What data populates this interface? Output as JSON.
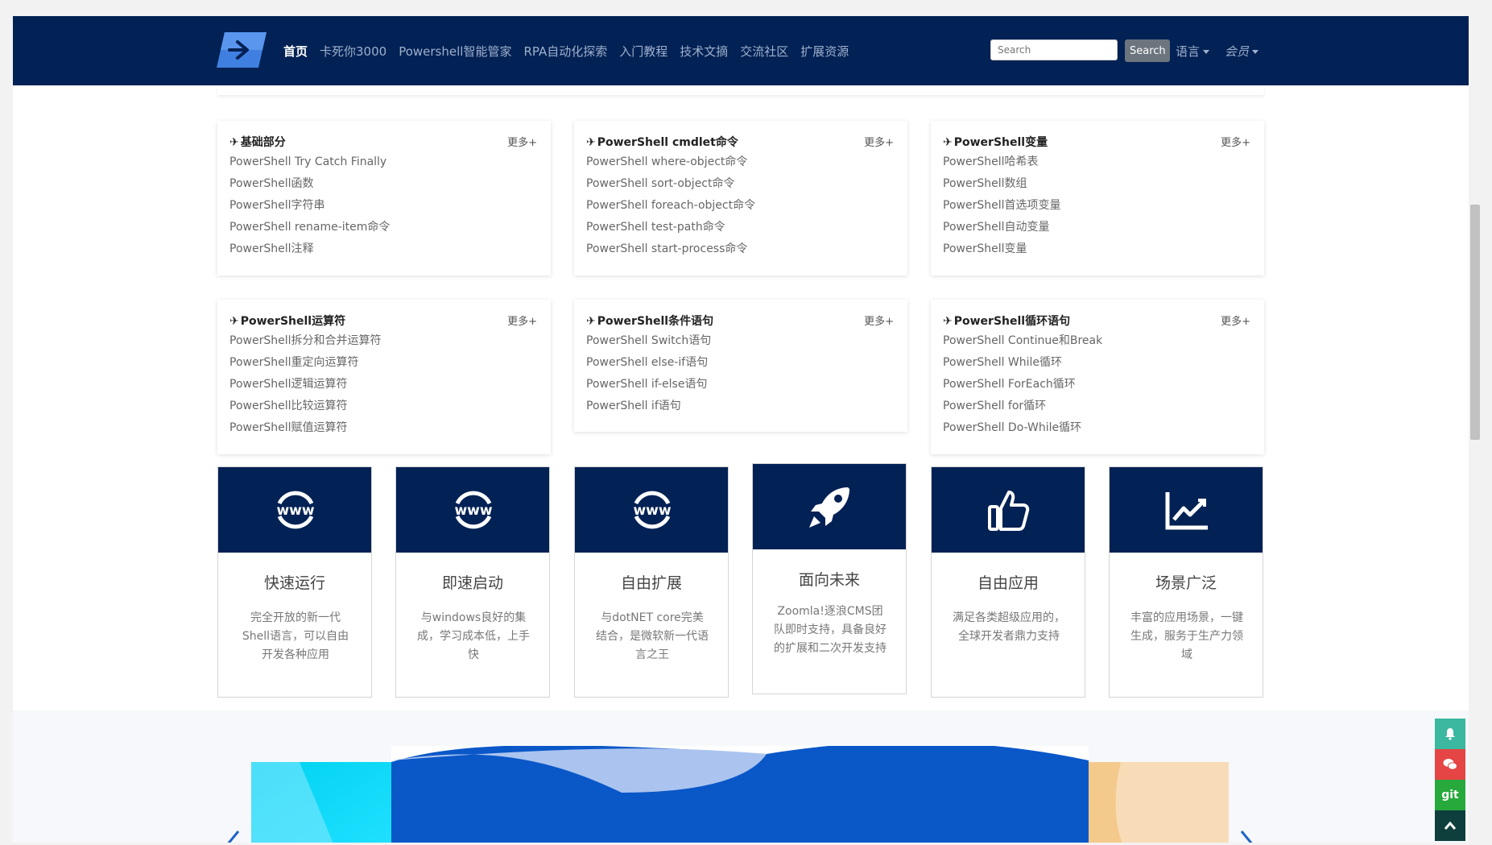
{
  "nav": {
    "links": [
      "首页",
      "卡死你3000",
      "Powershell智能管家",
      "RPA自动化探索",
      "入门教程",
      "技术文摘",
      "交流社区",
      "扩展资源"
    ],
    "search_placeholder": "Search",
    "search_button": "Search",
    "language": "语言",
    "member": "会员"
  },
  "cards": [
    {
      "title": "基础部分",
      "more": "更多+",
      "items": [
        "PowerShell Try Catch Finally",
        "PowerShell函数",
        "PowerShell字符串",
        "PowerShell rename-item命令",
        "PowerShell注释"
      ]
    },
    {
      "title": "PowerShell cmdlet命令",
      "more": "更多+",
      "items": [
        "PowerShell where-object命令",
        "PowerShell sort-object命令",
        "PowerShell foreach-object命令",
        "PowerShell test-path命令",
        "PowerShell start-process命令"
      ]
    },
    {
      "title": "PowerShell变量",
      "more": "更多+",
      "items": [
        "PowerShell哈希表",
        "PowerShell数组",
        "PowerShell首选项变量",
        "PowerShell自动变量",
        "PowerShell变量"
      ]
    },
    {
      "title": "PowerShell运算符",
      "more": "更多+",
      "items": [
        "PowerShell拆分和合并运算符",
        "PowerShell重定向运算符",
        "PowerShell逻辑运算符",
        "PowerShell比较运算符",
        "PowerShell赋值运算符"
      ]
    },
    {
      "title": "PowerShell条件语句",
      "more": "更多+",
      "items": [
        "PowerShell Switch语句",
        "PowerShell else-if语句",
        "PowerShell if-else语句",
        "PowerShell if语句"
      ]
    },
    {
      "title": "PowerShell循环语句",
      "more": "更多+",
      "items": [
        "PowerShell Continue和Break",
        "PowerShell While循环",
        "PowerShell ForEach循环",
        "PowerShell for循环",
        "PowerShell Do-While循环"
      ]
    }
  ],
  "features": [
    {
      "title": "快速运行",
      "desc": "完全开放的新一代Shell语言，可以自由开发各种应用",
      "icon": "www-icon"
    },
    {
      "title": "即速启动",
      "desc": "与windows良好的集成，学习成本低，上手快",
      "icon": "www-icon"
    },
    {
      "title": "自由扩展",
      "desc": "与dotNET core完美结合，是微软新一代语言之王",
      "icon": "www-icon"
    },
    {
      "title": "面向未来",
      "desc": "Zoomla!逐浪CMS团队即时支持，具备良好的扩展和二次开发支持",
      "icon": "rocket-icon"
    },
    {
      "title": "自由应用",
      "desc": "满足各类超级应用的，全球开发者鼎力支持",
      "icon": "thumbs-up-icon"
    },
    {
      "title": "场景广泛",
      "desc": "丰富的应用场景，一键生成，服务于生产力领域",
      "icon": "line-chart-icon"
    }
  ],
  "side_tools": [
    {
      "icon": "bell-icon",
      "color": "#3cb7a0"
    },
    {
      "icon": "wechat-icon",
      "color": "#e54545"
    },
    {
      "icon": "git-icon",
      "label": "git",
      "color": "#27a93c"
    },
    {
      "icon": "chevron-up-icon",
      "color": "#0e3f3c"
    }
  ],
  "colors": {
    "navbar": "#022154",
    "feature_head": "#022154",
    "banner_blue": "#0a57c8"
  }
}
